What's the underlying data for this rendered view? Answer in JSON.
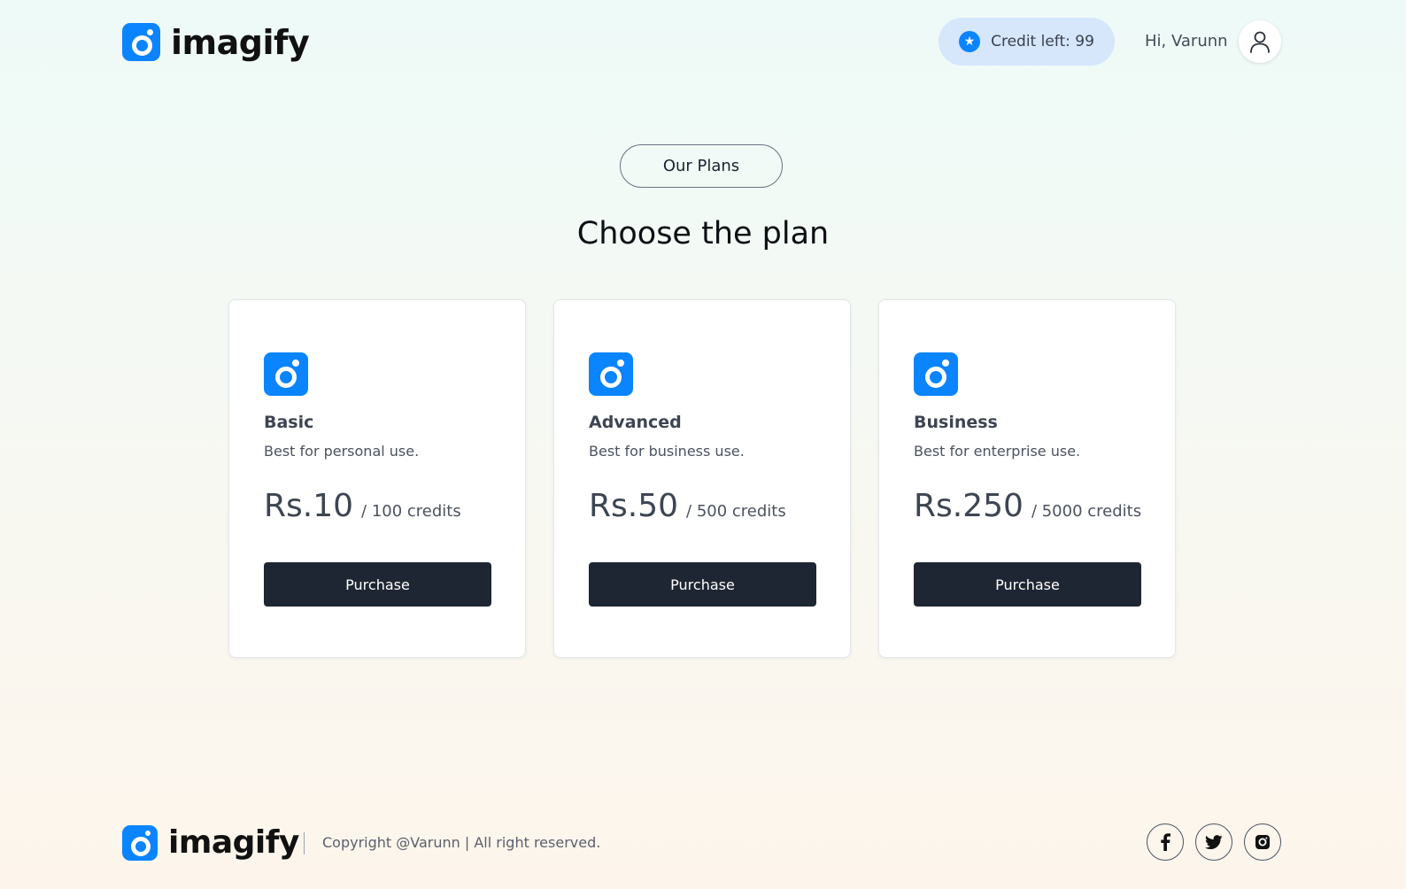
{
  "brand": {
    "name": "imagify",
    "color": "#0a84ff"
  },
  "header": {
    "credit_label": "Credit left: 99",
    "greeting": "Hi, Varunn",
    "star_icon": "star-icon",
    "avatar_icon": "user-icon"
  },
  "hero": {
    "badge": "Our Plans",
    "title": "Choose the plan"
  },
  "plans": [
    {
      "name": "Basic",
      "desc": "Best for personal use.",
      "price": "Rs.10",
      "per": "/ 100 credits",
      "button": "Purchase"
    },
    {
      "name": "Advanced",
      "desc": "Best for business use.",
      "price": "Rs.50",
      "per": "/ 500 credits",
      "button": "Purchase"
    },
    {
      "name": "Business",
      "desc": "Best for enterprise use.",
      "price": "Rs.250",
      "per": "/ 5000 credits",
      "button": "Purchase"
    }
  ],
  "footer": {
    "copyright": "Copyright @Varunn | All right reserved.",
    "social": [
      "facebook-icon",
      "twitter-icon",
      "instagram-icon"
    ]
  },
  "colors": {
    "button_bg": "#1f2633",
    "credit_pill_bg": "#d6e6fb"
  }
}
